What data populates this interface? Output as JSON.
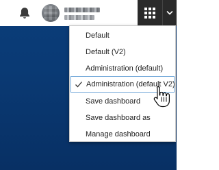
{
  "topbar": {
    "icons": {
      "notifications": "bell-icon",
      "avatar": "user-avatar",
      "apps": "grid-icon",
      "menu_toggle": "chevron-down-icon"
    },
    "user": {
      "name": "",
      "subtitle": ""
    }
  },
  "dashboard_menu": {
    "items": [
      {
        "label": "Default",
        "selected": false
      },
      {
        "label": "Default (V2)",
        "selected": false
      },
      {
        "label": "Administration (default)",
        "selected": false
      },
      {
        "label": "Administration (default V2)",
        "selected": true
      },
      {
        "label": "Save dashboard",
        "selected": false
      },
      {
        "label": "Save dashboard as",
        "selected": false
      },
      {
        "label": "Manage dashboard",
        "selected": false
      }
    ]
  },
  "colors": {
    "background": "#0a3a74",
    "topbar": "#ffffff",
    "apps_button": "#2a2a2a",
    "hover_border": "#6fa6d8"
  }
}
